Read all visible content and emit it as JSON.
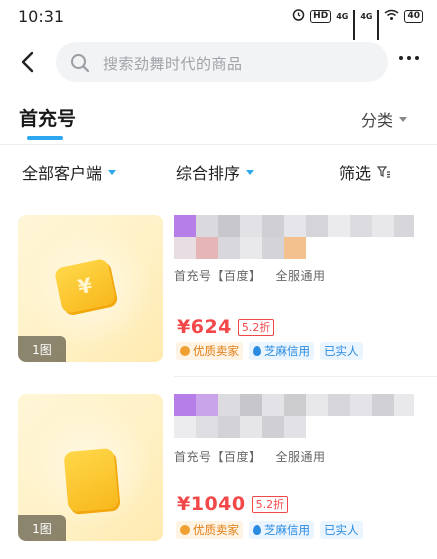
{
  "status_bar": {
    "time": "10:31",
    "hd_label": "HD",
    "net1": "4G",
    "net2": "4G",
    "battery": "40"
  },
  "search": {
    "placeholder": "搜索劲舞时代的商品"
  },
  "tabs": {
    "active": "首充号",
    "category_label": "分类"
  },
  "filters": {
    "client": "全部客户端",
    "sort": "综合排序",
    "filter": "筛选"
  },
  "listings": [
    {
      "image_count": "1图",
      "meta": [
        "首充号",
        "【百度】",
        "全服通用"
      ],
      "price": "¥624",
      "discount": "5.2折",
      "badges": [
        "优质卖家",
        "芝麻信用",
        "已实人"
      ]
    },
    {
      "image_count": "1图",
      "meta": [
        "首充号",
        "【百度】",
        "全服通用"
      ],
      "price": "¥1040",
      "discount": "5.2折",
      "badges": [
        "优质卖家",
        "芝麻信用",
        "已实人"
      ]
    }
  ],
  "colors": {
    "accent": "#2da8f0",
    "price": "#f2484a",
    "badge_gold": "#e07b14",
    "badge_blue": "#2b8be0"
  },
  "icons": [
    "back-arrow-icon",
    "search-icon",
    "more-icon",
    "caret-down-icon",
    "filter-icon"
  ]
}
